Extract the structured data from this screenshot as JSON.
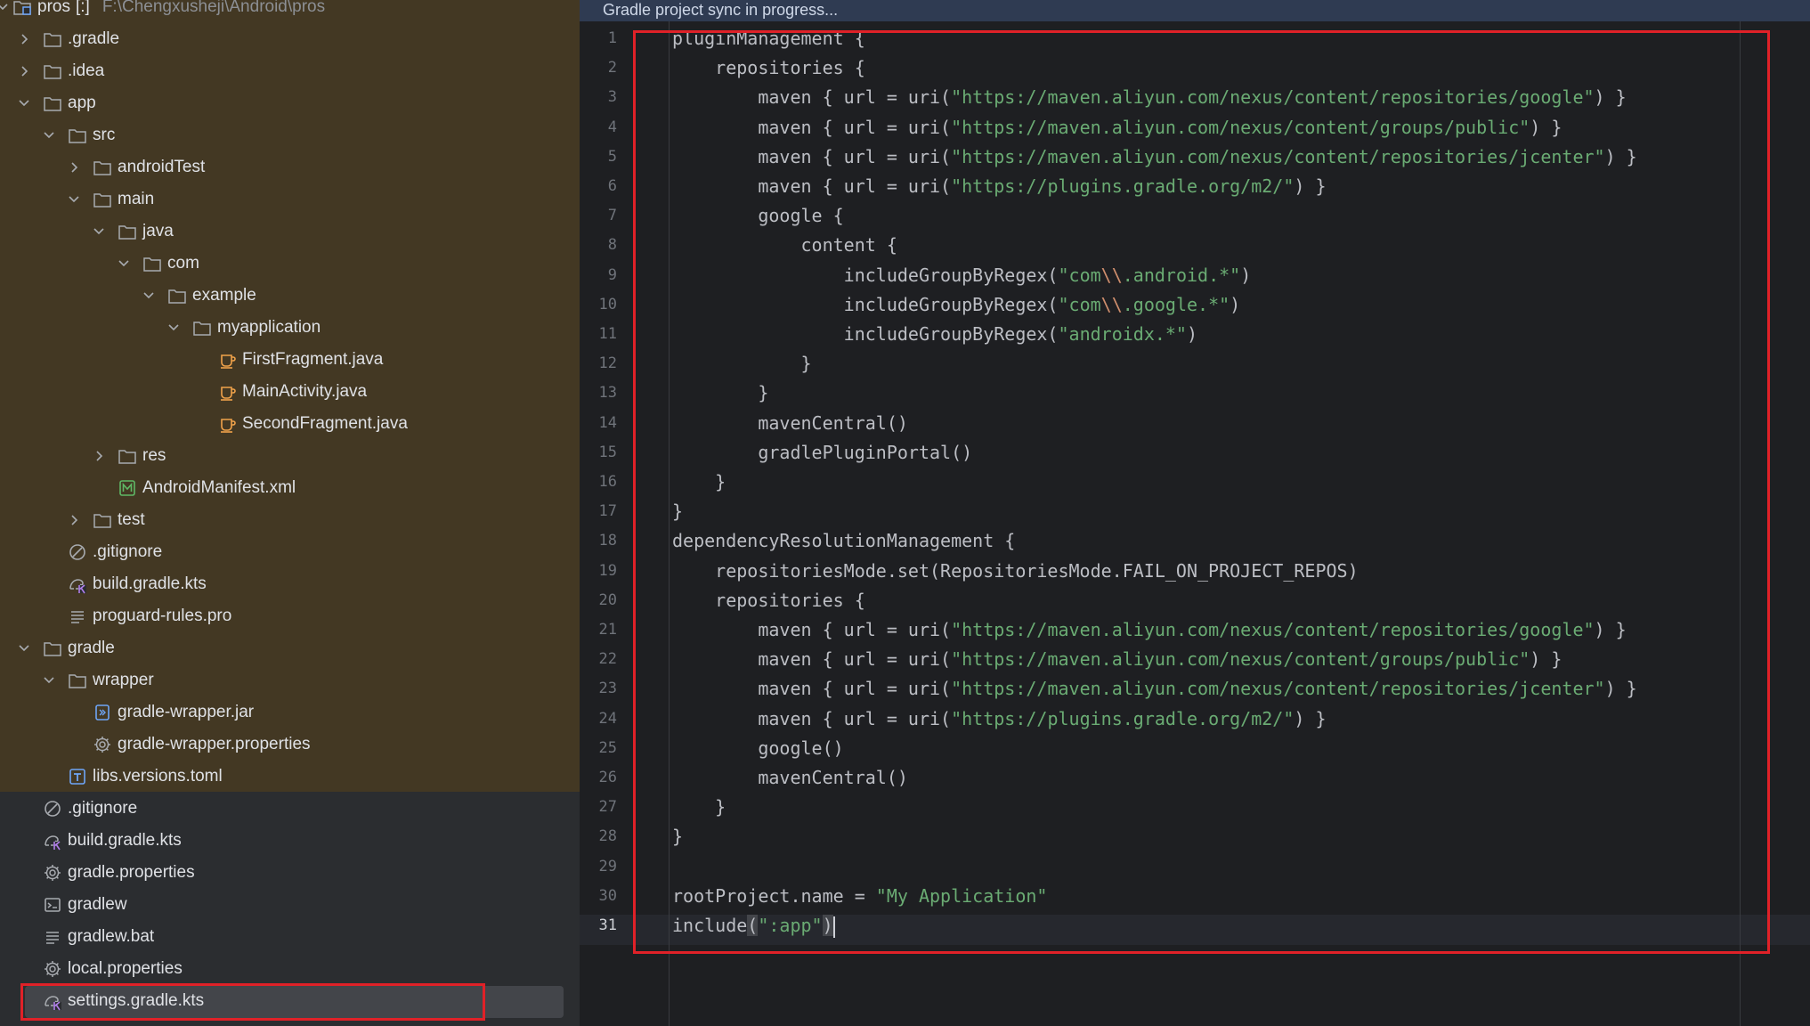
{
  "project": {
    "root_label": "pros",
    "root_badge": "[:]",
    "root_path": "F:\\Chengxusheji\\Android\\pros",
    "items": [
      {
        "label": ".gradle",
        "icon": "folder-icon",
        "depth": 1,
        "expand": "collapsed"
      },
      {
        "label": ".idea",
        "icon": "folder-icon",
        "depth": 1,
        "expand": "collapsed"
      },
      {
        "label": "app",
        "icon": "folder-icon",
        "depth": 1,
        "expand": "expanded"
      },
      {
        "label": "src",
        "icon": "folder-icon",
        "depth": 2,
        "expand": "expanded"
      },
      {
        "label": "androidTest",
        "icon": "folder-icon",
        "depth": 3,
        "expand": "collapsed"
      },
      {
        "label": "main",
        "icon": "folder-icon",
        "depth": 3,
        "expand": "expanded"
      },
      {
        "label": "java",
        "icon": "folder-icon",
        "depth": 4,
        "expand": "expanded"
      },
      {
        "label": "com",
        "icon": "folder-icon",
        "depth": 5,
        "expand": "expanded"
      },
      {
        "label": "example",
        "icon": "folder-icon",
        "depth": 6,
        "expand": "expanded"
      },
      {
        "label": "myapplication",
        "icon": "folder-icon",
        "depth": 7,
        "expand": "expanded"
      },
      {
        "label": "FirstFragment.java",
        "icon": "java-file-icon",
        "depth": 8,
        "expand": "none"
      },
      {
        "label": "MainActivity.java",
        "icon": "java-file-icon",
        "depth": 8,
        "expand": "none"
      },
      {
        "label": "SecondFragment.java",
        "icon": "java-file-icon",
        "depth": 8,
        "expand": "none"
      },
      {
        "label": "res",
        "icon": "folder-icon",
        "depth": 4,
        "expand": "collapsed"
      },
      {
        "label": "AndroidManifest.xml",
        "icon": "manifest-icon",
        "depth": 4,
        "expand": "none"
      },
      {
        "label": "test",
        "icon": "folder-icon",
        "depth": 3,
        "expand": "collapsed"
      },
      {
        "label": ".gitignore",
        "icon": "ignore-icon",
        "depth": 2,
        "expand": "none"
      },
      {
        "label": "build.gradle.kts",
        "icon": "gradle-kts-icon",
        "depth": 2,
        "expand": "none"
      },
      {
        "label": "proguard-rules.pro",
        "icon": "text-lines-icon",
        "depth": 2,
        "expand": "none"
      },
      {
        "label": "gradle",
        "icon": "folder-icon",
        "depth": 1,
        "expand": "expanded"
      },
      {
        "label": "wrapper",
        "icon": "folder-icon",
        "depth": 2,
        "expand": "expanded"
      },
      {
        "label": "gradle-wrapper.jar",
        "icon": "jar-icon",
        "depth": 3,
        "expand": "none"
      },
      {
        "label": "gradle-wrapper.properties",
        "icon": "gear-icon",
        "depth": 3,
        "expand": "none"
      },
      {
        "label": "libs.versions.toml",
        "icon": "toml-icon",
        "depth": 2,
        "expand": "none"
      },
      {
        "label": ".gitignore",
        "icon": "ignore-icon",
        "depth": 1,
        "expand": "none"
      },
      {
        "label": "build.gradle.kts",
        "icon": "gradle-kts-icon",
        "depth": 1,
        "expand": "none"
      },
      {
        "label": "gradle.properties",
        "icon": "gear-icon",
        "depth": 1,
        "expand": "none"
      },
      {
        "label": "gradlew",
        "icon": "terminal-icon",
        "depth": 1,
        "expand": "none"
      },
      {
        "label": "gradlew.bat",
        "icon": "text-lines-icon",
        "depth": 1,
        "expand": "none"
      },
      {
        "label": "local.properties",
        "icon": "gear-icon",
        "depth": 1,
        "expand": "none"
      },
      {
        "label": "settings.gradle.kts",
        "icon": "gradle-kts-icon",
        "depth": 1,
        "expand": "none",
        "selected": true
      }
    ]
  },
  "editor": {
    "status": "Gradle project sync in progress...",
    "current_line": 31,
    "lines": [
      [
        {
          "t": "pluginManagement {"
        }
      ],
      [
        {
          "t": "    repositories {"
        }
      ],
      [
        {
          "t": "        maven { url = uri("
        },
        {
          "t": "\"https://maven.aliyun.com/nexus/content/repositories/google\"",
          "k": "s"
        },
        {
          "t": ") }"
        }
      ],
      [
        {
          "t": "        maven { url = uri("
        },
        {
          "t": "\"https://maven.aliyun.com/nexus/content/groups/public\"",
          "k": "s"
        },
        {
          "t": ") }"
        }
      ],
      [
        {
          "t": "        maven { url = uri("
        },
        {
          "t": "\"https://maven.aliyun.com/nexus/content/repositories/jcenter\"",
          "k": "s"
        },
        {
          "t": ") }"
        }
      ],
      [
        {
          "t": "        maven { url = uri("
        },
        {
          "t": "\"https://plugins.gradle.org/m2/\"",
          "k": "s"
        },
        {
          "t": ") }"
        }
      ],
      [
        {
          "t": "        google {"
        }
      ],
      [
        {
          "t": "            content {"
        }
      ],
      [
        {
          "t": "                includeGroupByRegex("
        },
        {
          "t": "\"com",
          "k": "s"
        },
        {
          "t": "\\\\",
          "k": "esc"
        },
        {
          "t": ".android.*\"",
          "k": "s"
        },
        {
          "t": ")"
        }
      ],
      [
        {
          "t": "                includeGroupByRegex("
        },
        {
          "t": "\"com",
          "k": "s"
        },
        {
          "t": "\\\\",
          "k": "esc"
        },
        {
          "t": ".google.*\"",
          "k": "s"
        },
        {
          "t": ")"
        }
      ],
      [
        {
          "t": "                includeGroupByRegex("
        },
        {
          "t": "\"androidx.*\"",
          "k": "s"
        },
        {
          "t": ")"
        }
      ],
      [
        {
          "t": "            }"
        }
      ],
      [
        {
          "t": "        }"
        }
      ],
      [
        {
          "t": "        mavenCentral()"
        }
      ],
      [
        {
          "t": "        gradlePluginPortal()"
        }
      ],
      [
        {
          "t": "    }"
        }
      ],
      [
        {
          "t": "}"
        }
      ],
      [
        {
          "t": "dependencyResolutionManagement {"
        }
      ],
      [
        {
          "t": "    repositoriesMode.set(RepositoriesMode.FAIL_ON_PROJECT_REPOS)"
        }
      ],
      [
        {
          "t": "    repositories {"
        }
      ],
      [
        {
          "t": "        maven { url = uri("
        },
        {
          "t": "\"https://maven.aliyun.com/nexus/content/repositories/google\"",
          "k": "s"
        },
        {
          "t": ") }"
        }
      ],
      [
        {
          "t": "        maven { url = uri("
        },
        {
          "t": "\"https://maven.aliyun.com/nexus/content/groups/public\"",
          "k": "s"
        },
        {
          "t": ") }"
        }
      ],
      [
        {
          "t": "        maven { url = uri("
        },
        {
          "t": "\"https://maven.aliyun.com/nexus/content/repositories/jcenter\"",
          "k": "s"
        },
        {
          "t": ") }"
        }
      ],
      [
        {
          "t": "        maven { url = uri("
        },
        {
          "t": "\"https://plugins.gradle.org/m2/\"",
          "k": "s"
        },
        {
          "t": ") }"
        }
      ],
      [
        {
          "t": "        google()"
        }
      ],
      [
        {
          "t": "        mavenCentral()"
        }
      ],
      [
        {
          "t": "    }"
        }
      ],
      [
        {
          "t": "}"
        }
      ],
      [],
      [
        {
          "t": "rootProject.name = "
        },
        {
          "t": "\"My Application\"",
          "k": "s"
        }
      ],
      [
        {
          "t": "include"
        },
        {
          "t": "(",
          "k": "hl"
        },
        {
          "t": "\":app\"",
          "k": "s"
        },
        {
          "t": ")",
          "k": "hl"
        },
        {
          "k": "caret"
        }
      ]
    ]
  },
  "colors": {
    "tree_bg": "#2b2d30",
    "tree_highlight_bg": "#433823",
    "editor_bg": "#1e1f22",
    "string": "#6aab73",
    "escape": "#cf8e6d",
    "annotation_red": "#e02128"
  }
}
